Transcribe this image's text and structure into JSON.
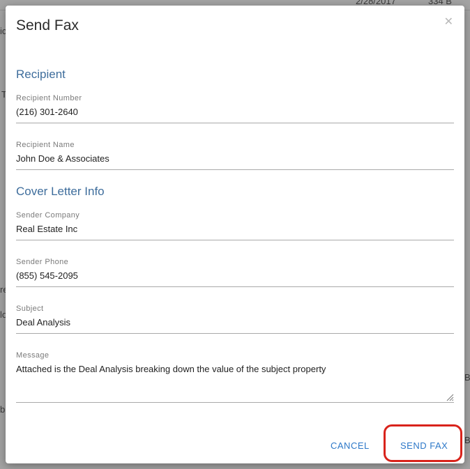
{
  "background": {
    "fragments": [
      "2/28/2017",
      "334 B",
      "ic",
      "T",
      "re",
      "lo",
      "b",
      "B",
      "B"
    ]
  },
  "modal": {
    "title": "Send Fax",
    "close_icon": "close-icon"
  },
  "sections": {
    "recipient": {
      "title": "Recipient",
      "number_label": "Recipient Number",
      "number_value": "(216) 301-2640",
      "name_label": "Recipient Name",
      "name_value": "John Doe & Associates"
    },
    "cover_letter": {
      "title": "Cover Letter Info",
      "company_label": "Sender Company",
      "company_value": "Real Estate Inc",
      "phone_label": "Sender Phone",
      "phone_value": "(855) 545-2095",
      "subject_label": "Subject",
      "subject_value": "Deal Analysis",
      "message_label": "Message",
      "message_value": "Attached is the Deal Analysis breaking down the value of the subject property"
    }
  },
  "footer": {
    "cancel_label": "CANCEL",
    "send_label": "SEND FAX"
  },
  "colors": {
    "accent": "#2d78c8",
    "section_title": "#3e6d9c",
    "highlight": "#d9231b"
  }
}
